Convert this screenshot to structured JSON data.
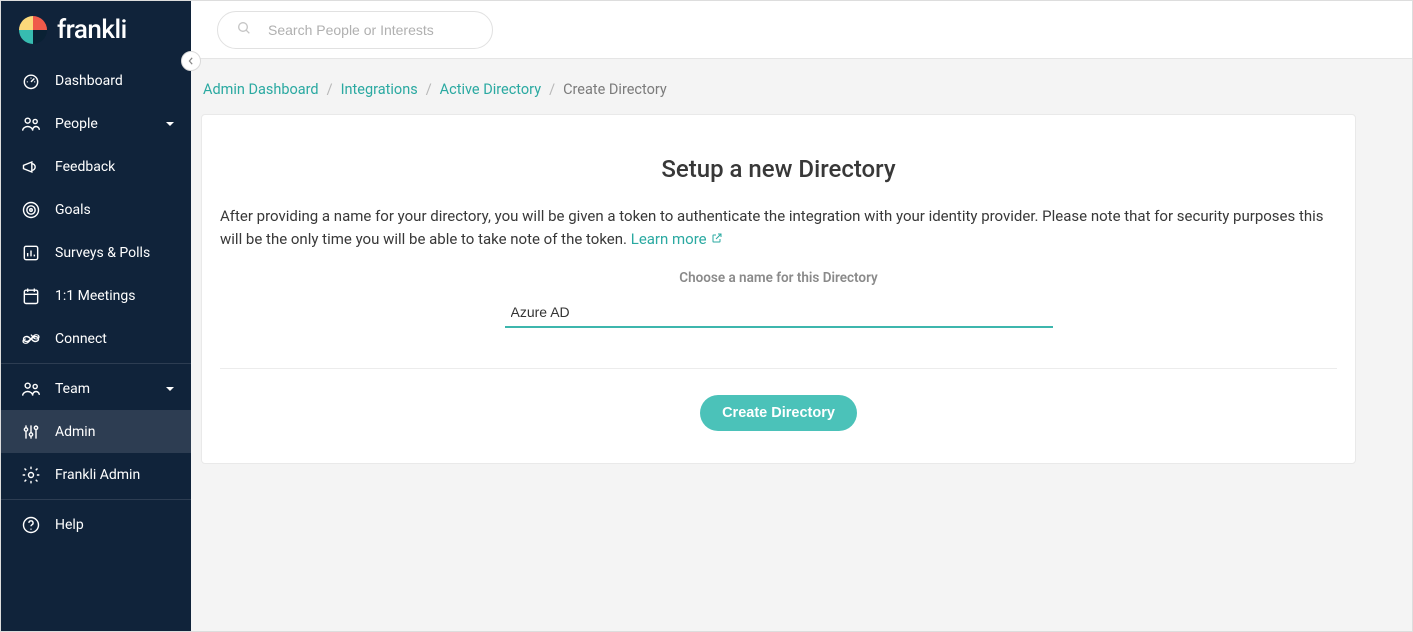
{
  "brand": {
    "name": "frankli"
  },
  "search": {
    "placeholder": "Search People or Interests"
  },
  "sidebar": {
    "items": [
      {
        "label": "Dashboard",
        "icon": "gauge-icon",
        "caret": false
      },
      {
        "label": "People",
        "icon": "people-icon",
        "caret": true
      },
      {
        "label": "Feedback",
        "icon": "megaphone-icon",
        "caret": false
      },
      {
        "label": "Goals",
        "icon": "target-icon",
        "caret": false
      },
      {
        "label": "Surveys & Polls",
        "icon": "barchart-icon",
        "caret": false
      },
      {
        "label": "1:1 Meetings",
        "icon": "calendar-icon",
        "caret": false
      },
      {
        "label": "Connect",
        "icon": "infinity-icon",
        "caret": false
      },
      {
        "label": "Team",
        "icon": "people-icon",
        "caret": true
      },
      {
        "label": "Admin",
        "icon": "sliders-icon",
        "caret": false,
        "active": true
      },
      {
        "label": "Frankli Admin",
        "icon": "gear-icon",
        "caret": false
      },
      {
        "label": "Help",
        "icon": "question-icon",
        "caret": false
      }
    ]
  },
  "breadcrumb": [
    {
      "label": "Admin Dashboard",
      "link": true
    },
    {
      "label": "Integrations",
      "link": true
    },
    {
      "label": "Active Directory",
      "link": true
    },
    {
      "label": "Create Directory",
      "link": false
    }
  ],
  "card": {
    "title": "Setup a new Directory",
    "description": "After providing a name for your directory, you will be given a token to authenticate the integration with your identity provider. Please note that for security purposes this will be the only time you will be able to take note of the token.",
    "learn_more": "Learn more",
    "field_label": "Choose a name for this Directory",
    "field_value": "Azure AD",
    "submit_label": "Create Directory"
  }
}
